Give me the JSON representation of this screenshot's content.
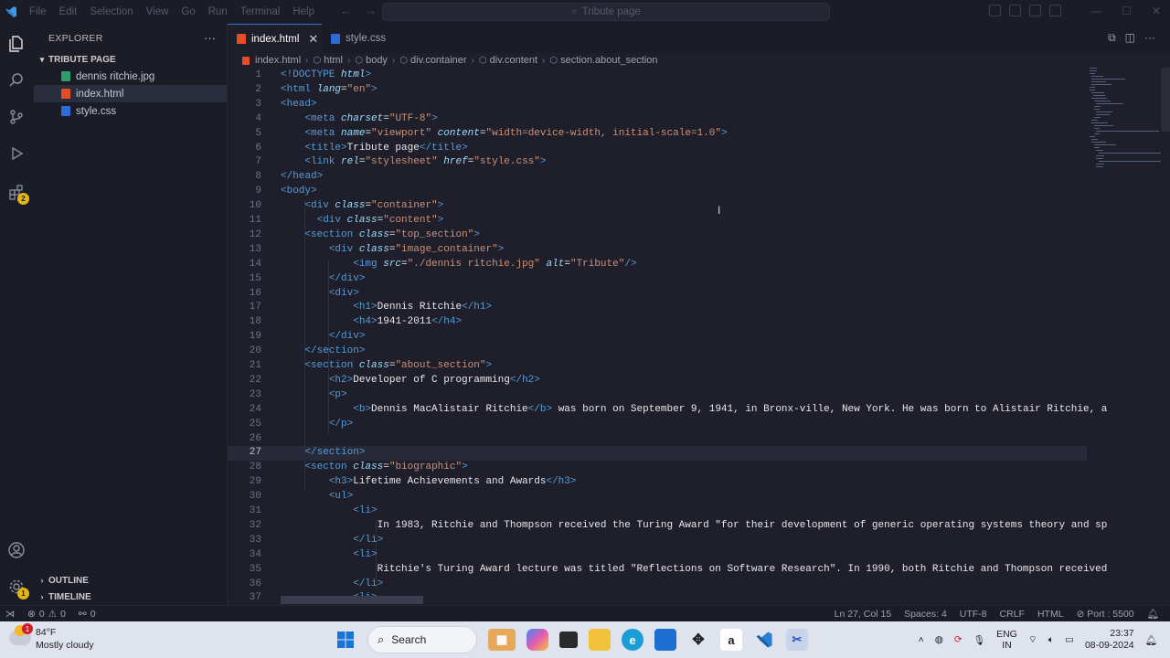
{
  "titlebar": {
    "menu": [
      "File",
      "Edit",
      "Selection",
      "View",
      "Go",
      "Run",
      "Terminal",
      "Help"
    ],
    "command_center": "Tribute page"
  },
  "activity": {
    "extensions_badge": "2",
    "manage_badge": "1"
  },
  "sidebar": {
    "title": "EXPLORER",
    "folder": "TRIBUTE PAGE",
    "files": [
      {
        "name": "dennis ritchie.jpg",
        "type": "image"
      },
      {
        "name": "index.html",
        "type": "html"
      },
      {
        "name": "style.css",
        "type": "css"
      }
    ],
    "outline": "OUTLINE",
    "timeline": "TIMELINE"
  },
  "tabs": [
    {
      "label": "index.html",
      "active": true
    },
    {
      "label": "style.css",
      "active": false
    }
  ],
  "breadcrumb": [
    "index.html",
    "html",
    "body",
    "div.container",
    "div.content",
    "section.about_section"
  ],
  "editor": {
    "current_line": 27,
    "lines": [
      {
        "n": "1",
        "t": "<!DOCTYPE html>"
      },
      {
        "n": "2",
        "t": "<html lang=\"en\">"
      },
      {
        "n": "3",
        "t": "<head>"
      },
      {
        "n": "4",
        "t": "    <meta charset=\"UTF-8\">"
      },
      {
        "n": "5",
        "t": "    <meta name=\"viewport\" content=\"width=device-width, initial-scale=1.0\">"
      },
      {
        "n": "6",
        "t": "    <title>Tribute page</title>"
      },
      {
        "n": "7",
        "t": "    <link rel=\"stylesheet\" href=\"style.css\">"
      },
      {
        "n": "8",
        "t": "</head>"
      },
      {
        "n": "9",
        "t": "<body>"
      },
      {
        "n": "10",
        "t": "    <div class=\"container\">"
      },
      {
        "n": "11",
        "t": "      <div class=\"content\">"
      },
      {
        "n": "12",
        "t": "    <section class=\"top_section\">"
      },
      {
        "n": "13",
        "t": "        <div class=\"image_container\">"
      },
      {
        "n": "14",
        "t": "            <img src=\"./dennis ritchie.jpg\" alt=\"Tribute\"/>"
      },
      {
        "n": "15",
        "t": "        </div>"
      },
      {
        "n": "16",
        "t": "        <div>"
      },
      {
        "n": "17",
        "t": "            <h1>Dennis Ritchie</h1>"
      },
      {
        "n": "18",
        "t": "            <h4>1941-2011</h4>"
      },
      {
        "n": "19",
        "t": "        </div>"
      },
      {
        "n": "20",
        "t": "    </section>"
      },
      {
        "n": "21",
        "t": "    <section class=\"about_section\">"
      },
      {
        "n": "22",
        "t": "        <h2>Developer of C programming</h2>"
      },
      {
        "n": "23",
        "t": "        <p>"
      },
      {
        "n": "24",
        "t": "            <b>Dennis MacAlistair Ritchie</b> was born on September 9, 1941, in Bronx-ville, New York. He was born to Alistair Ritchie, a"
      },
      {
        "n": "25",
        "t": "        </p>"
      },
      {
        "n": "26",
        "t": ""
      },
      {
        "n": "27",
        "t": "    </section>"
      },
      {
        "n": "28",
        "t": "    <secton class=\"biographic\">"
      },
      {
        "n": "29",
        "t": "        <h3>Lifetime Achievements and Awards</h3>"
      },
      {
        "n": "30",
        "t": "        <ul>"
      },
      {
        "n": "31",
        "t": "            <li>"
      },
      {
        "n": "32",
        "t": "                In 1983, Ritchie and Thompson received the Turing Award \"for their development of generic operating systems theory and sp"
      },
      {
        "n": "33",
        "t": "            </li>"
      },
      {
        "n": "34",
        "t": "            <li>"
      },
      {
        "n": "35",
        "t": "                Ritchie's Turing Award lecture was titled \"Reflections on Software Research\". In 1990, both Ritchie and Thompson received"
      },
      {
        "n": "36",
        "t": "            </li>"
      },
      {
        "n": "37",
        "t": "            <li>"
      }
    ]
  },
  "statusbar": {
    "errors": "0",
    "warnings": "0",
    "ports": "0",
    "position": "Ln 27, Col 15",
    "spaces": "Spaces: 4",
    "encoding": "UTF-8",
    "eol": "CRLF",
    "language": "HTML",
    "port": "Port : 5500"
  },
  "taskbar": {
    "weather_temp": "84°F",
    "weather_desc": "Mostly cloudy",
    "weather_badge": "1",
    "search": "Search",
    "lang1": "ENG",
    "lang2": "IN",
    "time": "23:37",
    "date": "08-09-2024"
  },
  "colors": {
    "accent": "#3d6bd8",
    "tag": "#569cd6",
    "attr": "#9cdcfe",
    "string": "#ce9178"
  }
}
